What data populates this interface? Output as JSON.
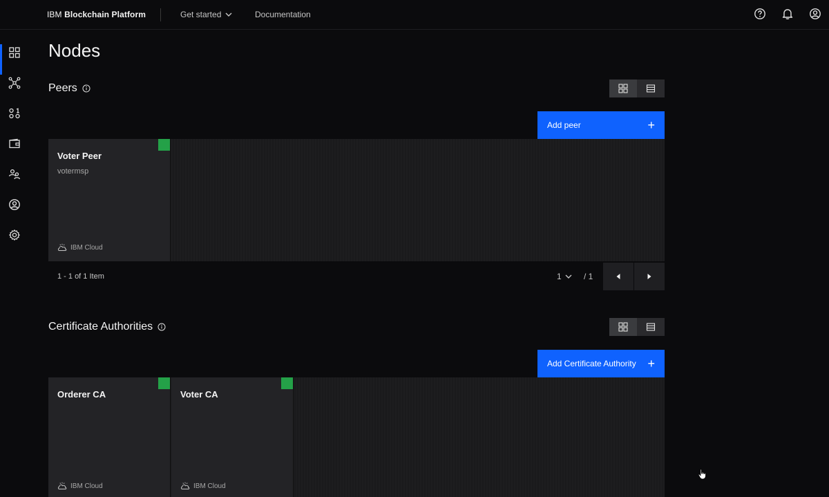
{
  "header": {
    "brand_prefix": "IBM",
    "brand_name": "Blockchain Platform",
    "nav": [
      {
        "label": "Get started",
        "has_dropdown": true
      },
      {
        "label": "Documentation",
        "has_dropdown": false
      }
    ],
    "icons": [
      "help-icon",
      "notification-icon",
      "user-avatar-icon"
    ]
  },
  "sidebar": {
    "items": [
      {
        "icon": "nodes-grid-icon",
        "active": true
      },
      {
        "icon": "network-channels-icon",
        "active": false
      },
      {
        "icon": "smart-contracts-icon",
        "active": false
      },
      {
        "icon": "wallet-icon",
        "active": false
      },
      {
        "icon": "organizations-icon",
        "active": false
      },
      {
        "icon": "users-icon",
        "active": false
      },
      {
        "icon": "settings-icon",
        "active": false
      }
    ]
  },
  "page": {
    "title": "Nodes"
  },
  "peers": {
    "title": "Peers",
    "add_label": "Add peer",
    "tiles": [
      {
        "name": "Voter Peer",
        "sub": "votermsp",
        "platform": "IBM Cloud",
        "status_color": "#24a148"
      }
    ],
    "pagination": {
      "range_text": "1 - 1 of 1 Item",
      "page": "1",
      "total": "/ 1"
    }
  },
  "cas": {
    "title": "Certificate Authorities",
    "add_label": "Add Certificate Authority",
    "tiles": [
      {
        "name": "Orderer CA",
        "platform": "IBM Cloud",
        "status_color": "#24a148"
      },
      {
        "name": "Voter CA",
        "platform": "IBM Cloud",
        "status_color": "#24a148"
      }
    ]
  },
  "colors": {
    "accent": "#0f62fe",
    "status_ok": "#24a148",
    "background": "#0b0b0d"
  }
}
